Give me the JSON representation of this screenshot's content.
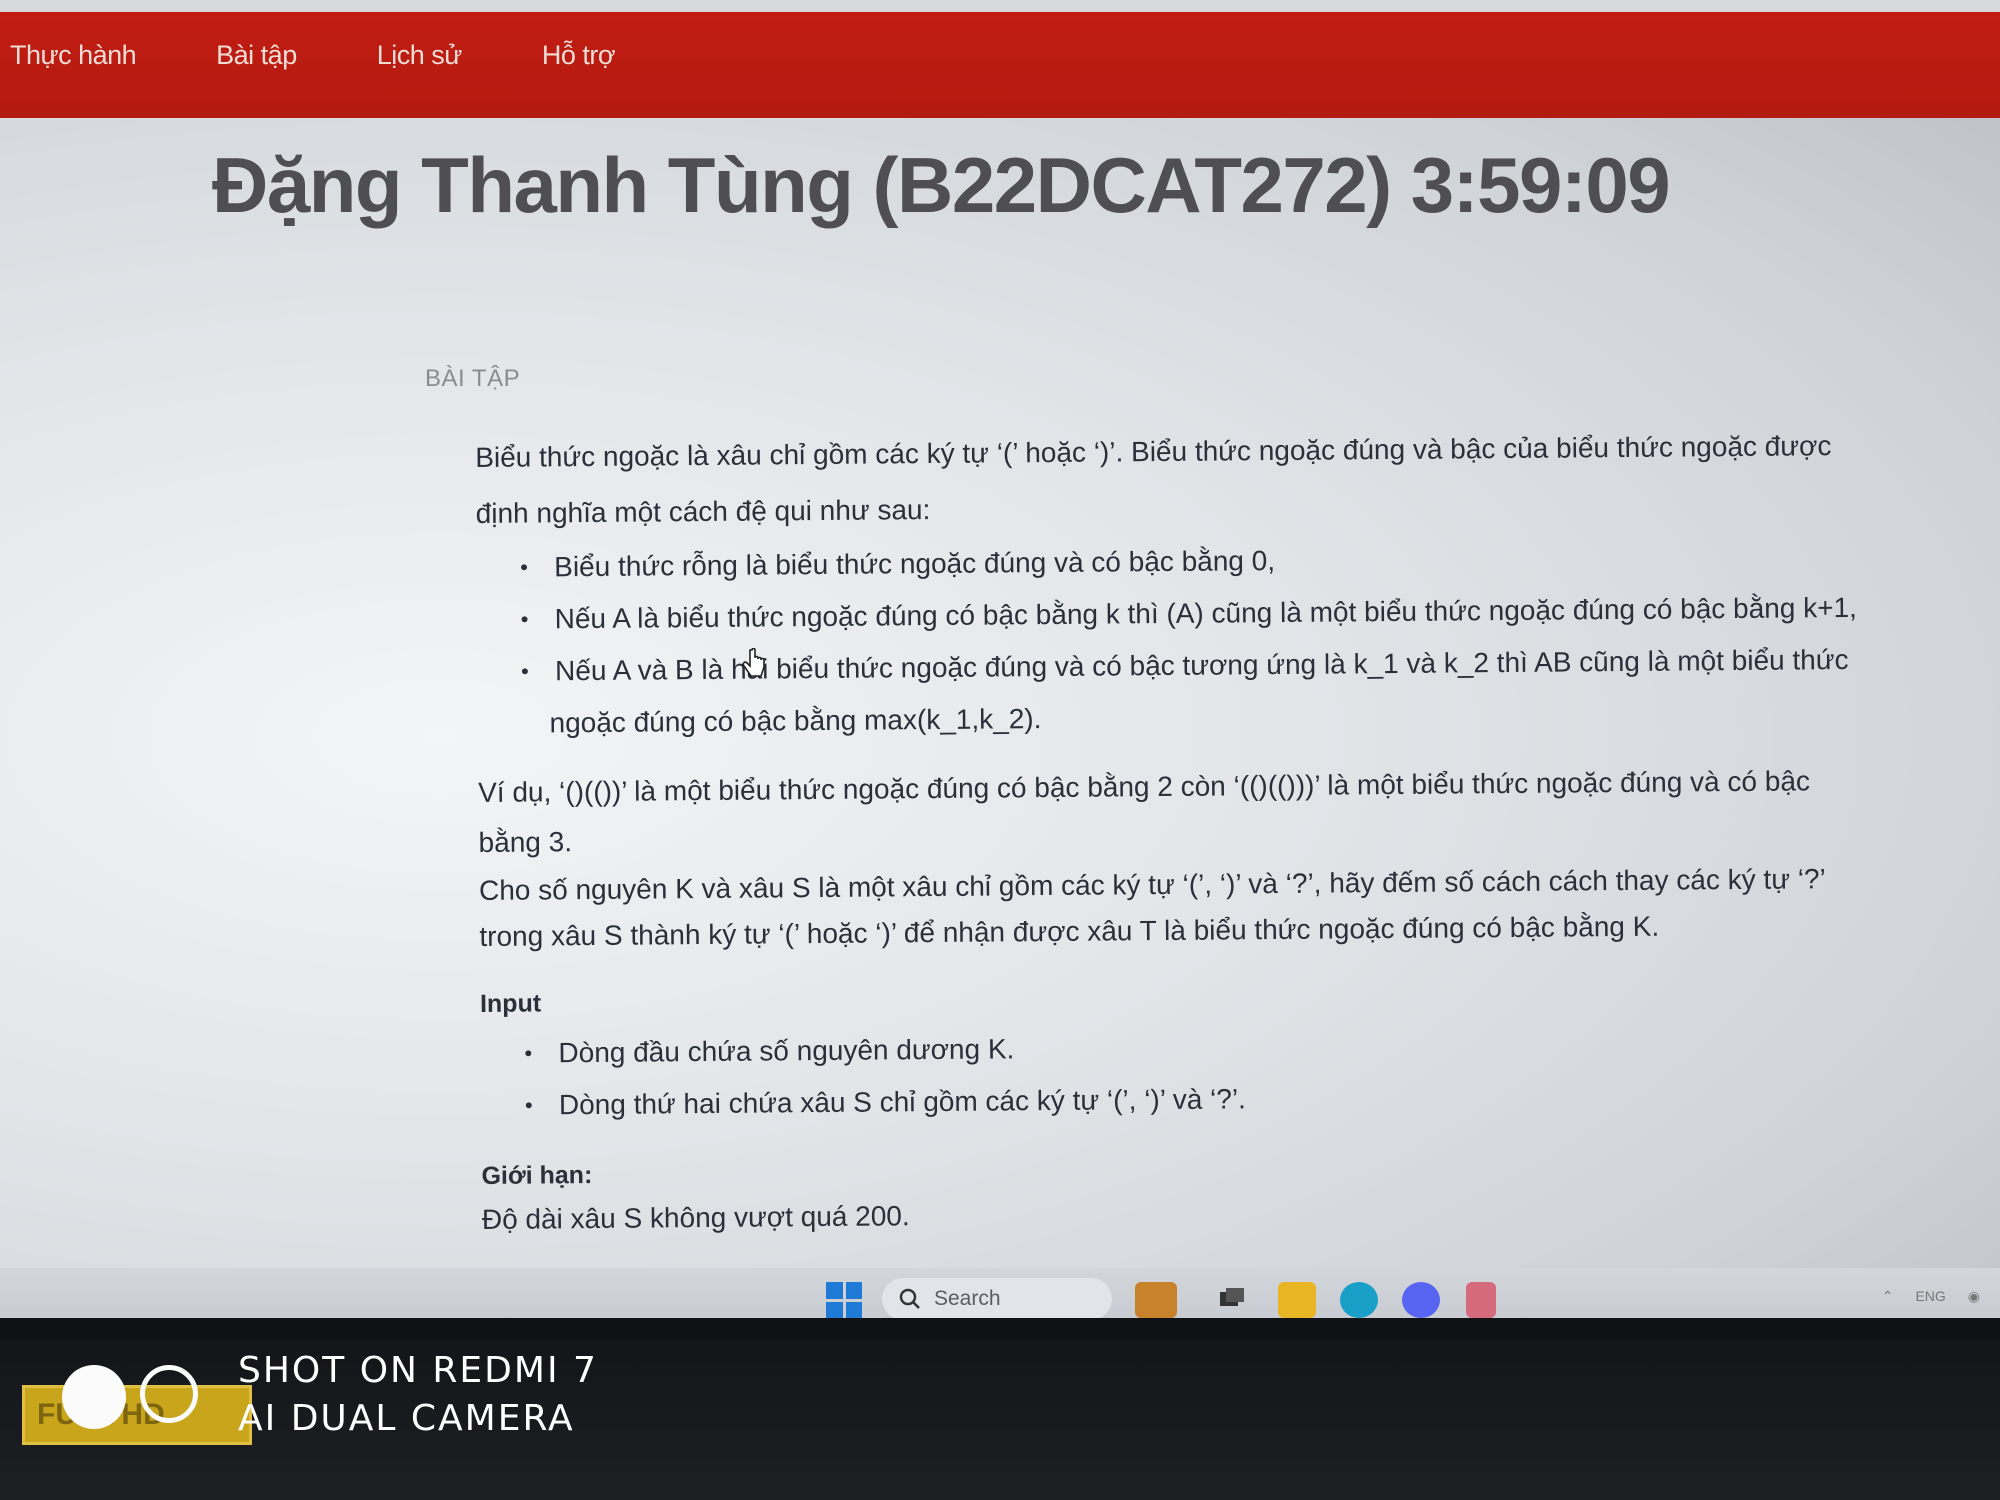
{
  "nav": {
    "items": [
      "Thực hành",
      "Bài tập",
      "Lịch sử",
      "Hỗ trợ"
    ]
  },
  "page": {
    "title": "Đặng Thanh Tùng (B22DCAT272) 3:59:09",
    "section_label": "BÀI TẬP"
  },
  "problem": {
    "intro": "Biểu thức ngoặc là xâu chỉ gồm các ký tự ‘(’ hoặc ‘)’. Biểu thức ngoặc đúng và bậc của biểu thức ngoặc được định nghĩa một cách đệ qui như sau:",
    "rules": [
      "Biểu thức rỗng là biểu thức ngoặc đúng và có bậc bằng 0,",
      "Nếu A là biểu thức ngoặc đúng có bậc bằng k thì (A) cũng là một biểu thức ngoặc đúng có bậc bằng k+1,",
      "Nếu A và B là hai biểu thức ngoặc đúng và có bậc tương ứng là k_1 và k_2 thì AB cũng là một biểu thức ngoặc đúng có bậc bằng max(k_1,k_2)."
    ],
    "example": "Ví dụ, ‘()(())’ là một biểu thức ngoặc đúng có bậc bằng 2 còn ‘(()(()))’ là một biểu thức ngoặc đúng và có bậc bằng 3.",
    "task": "Cho số nguyên K và xâu S là một xâu chỉ gồm các ký tự ‘(’, ‘)’ và ‘?’, hãy đếm số cách cách thay các ký tự ‘?’ trong xâu S thành ký tự ‘(’ hoặc ‘)’ để nhận được xâu T là biểu thức ngoặc đúng có bậc bằng K.",
    "input_heading": "Input",
    "input_items": [
      "Dòng đầu chứa số nguyên dương K.",
      "Dòng thứ hai chứa xâu S chỉ gồm các ký tự ‘(’, ‘)’ và ‘?’."
    ],
    "limits_heading": "Giới hạn:",
    "limits_text": "Độ dài xâu S không vượt quá 200."
  },
  "taskbar": {
    "search_placeholder": "Search",
    "tray_lang": "ENG"
  },
  "watermark": {
    "badge": "FULL HD",
    "line1": "SHOT ON REDMI 7",
    "line2": "AI DUAL CAMERA"
  },
  "colors": {
    "topbar": "#b31a10",
    "title": "#4f4f53",
    "text": "#2b2f3a",
    "windows_blue": "#1f7ad6"
  }
}
